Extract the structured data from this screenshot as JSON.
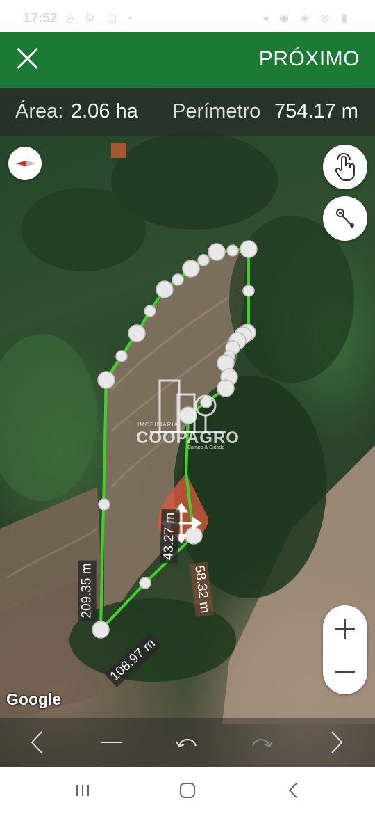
{
  "status_bar": {
    "time": "17:52",
    "left_icons": "◎ ⚙ ▢ •",
    "right_icons": "◂ ◉ ◈ ⊘ ▮"
  },
  "app_bar": {
    "close_icon": "close-icon",
    "next_label": "PRÓXIMO",
    "color": "#1b7a34"
  },
  "info": {
    "area_label": "Área:",
    "area_value": "2.06 ha",
    "perimeter_label": "Perímetro",
    "perimeter_value": "754.17 m"
  },
  "map": {
    "segment_labels": {
      "left": "209.35 m",
      "bottom": "108.97 m",
      "inner_left": "43.27 m",
      "inner_right": "58.32 m"
    },
    "watermark": {
      "title": "IMOBILIÁRIA",
      "brand": "COOPAGRO",
      "subtitle": "Campo & Cidade"
    },
    "google_label": "Google",
    "polygon_color": "#3fd12a"
  },
  "toolbar": {
    "prev": "chevron-left-icon",
    "delete": "minus-icon",
    "undo": "undo-icon",
    "redo": "redo-icon",
    "next": "chevron-right-icon"
  },
  "nav": {
    "recents": "recents-icon",
    "home": "home-icon",
    "back": "back-icon"
  }
}
